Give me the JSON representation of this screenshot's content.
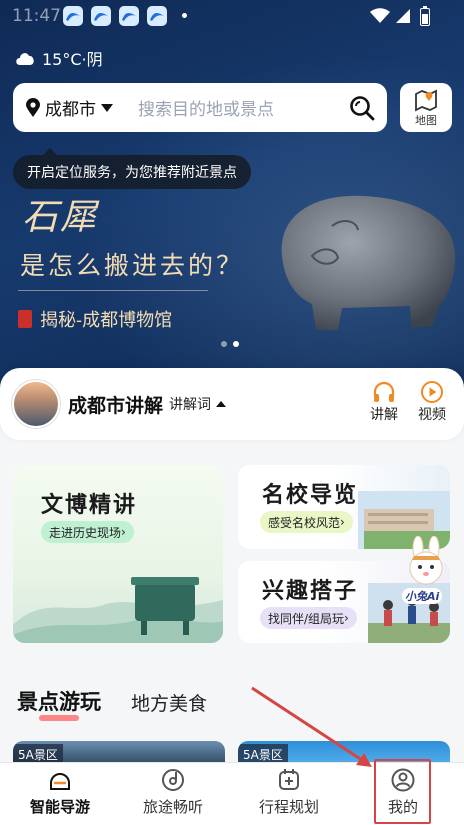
{
  "status_bar": {
    "time": "11:47"
  },
  "weather": {
    "text": "15°C·阴",
    "icon": "cloud-icon"
  },
  "search": {
    "city": "成都市",
    "placeholder": "搜索目的地或景点"
  },
  "map_button": {
    "label": "地图"
  },
  "location_tip": {
    "text": "开启定位服务，为您推荐附近景点"
  },
  "banner": {
    "title_line1": "石犀",
    "title_line2": "是怎么搬进去的？",
    "subtitle": "揭秘-成都博物馆",
    "page_count": 2,
    "active_page": 2
  },
  "city_guide": {
    "title": "成都市讲解",
    "sub_label": "讲解词",
    "actions": [
      {
        "label": "讲解",
        "icon": "headphones-icon"
      },
      {
        "label": "视频",
        "icon": "play-icon"
      }
    ]
  },
  "cards": {
    "wenbo": {
      "title": "文博精讲",
      "tag": "走进历史现场"
    },
    "mingxiao": {
      "title": "名校导览",
      "tag": "感受名校风范"
    },
    "xingqu": {
      "title": "兴趣搭子",
      "tag": "找同伴/组局玩"
    },
    "mascot_label": "小兔Ai"
  },
  "section_tabs": {
    "active": "景点游玩",
    "inactive": "地方美食"
  },
  "spots": [
    {
      "badge": "5A景区"
    },
    {
      "badge": "5A景区"
    }
  ],
  "bottom_nav": [
    {
      "label": "智能导游",
      "icon": "smart-guide-icon",
      "active": true
    },
    {
      "label": "旅途畅听",
      "icon": "music-disc-icon",
      "active": false
    },
    {
      "label": "行程规划",
      "icon": "calendar-plus-icon",
      "active": false
    },
    {
      "label": "我的",
      "icon": "profile-icon",
      "active": false
    }
  ],
  "colors": {
    "hero": "#173a6e",
    "accent_orange": "#f08a24",
    "highlight_red": "#d64545"
  }
}
